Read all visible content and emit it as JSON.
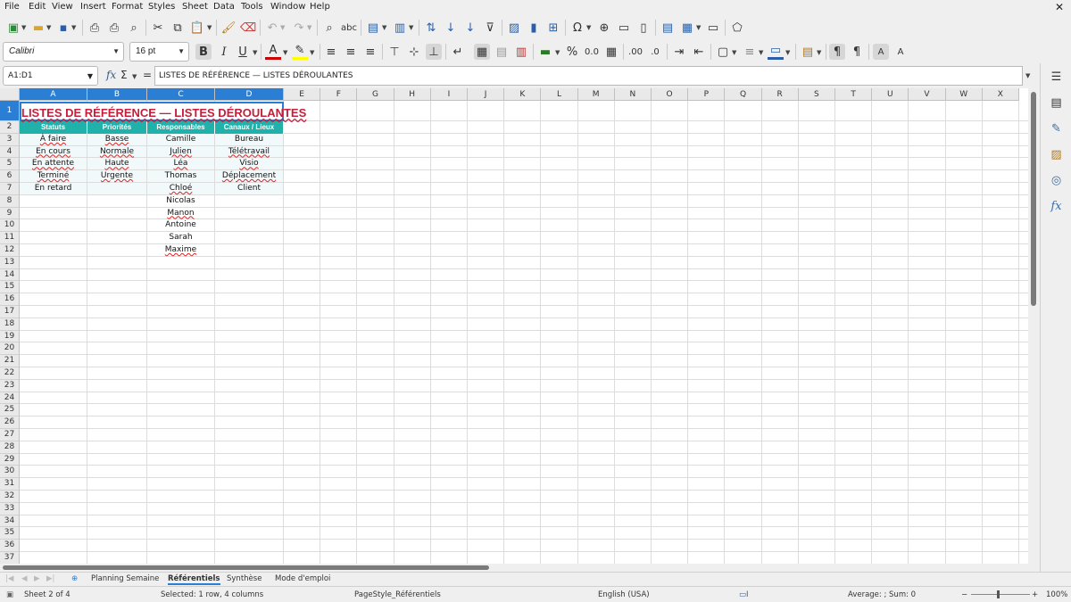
{
  "menu": [
    "File",
    "Edit",
    "View",
    "Insert",
    "Format",
    "Styles",
    "Sheet",
    "Data",
    "Tools",
    "Window",
    "Help"
  ],
  "font": {
    "name": "Calibri",
    "size": "16 pt"
  },
  "namebox": "A1:D1",
  "formula": "LISTES DE RÉFÉRENCE — LISTES DÉROULANTES",
  "columns": [
    "A",
    "B",
    "C",
    "D",
    "E",
    "F",
    "G",
    "H",
    "I",
    "J",
    "K",
    "L",
    "M",
    "N",
    "O",
    "P",
    "Q",
    "R",
    "S",
    "T",
    "U",
    "V",
    "W",
    "X"
  ],
  "sheet": {
    "title": "LISTES DE RÉFÉRENCE — LISTES DÉROULANTES",
    "headers": [
      "Statuts",
      "Priorités",
      "Responsables",
      "Canaux / Lieux"
    ],
    "statuts": [
      "À faire",
      "En cours",
      "En attente",
      "Terminé",
      "En retard"
    ],
    "priorites": [
      "Basse",
      "Normale",
      "Haute",
      "Urgente"
    ],
    "responsables": [
      "Camille",
      "Julien",
      "Léa",
      "Thomas",
      "Chloé",
      "Nicolas",
      "Manon",
      "Antoine",
      "Sarah",
      "Maxime"
    ],
    "canaux": [
      "Bureau",
      "Télétravail",
      "Visio",
      "Déplacement",
      "Client"
    ]
  },
  "tabs": [
    "Planning Semaine",
    "Référentiels",
    "Synthèse",
    "Mode d'emploi"
  ],
  "status": {
    "sheet": "Sheet 2 of 4",
    "selection": "Selected: 1 row, 4 columns",
    "pagestyle": "PageStyle_Référentiels",
    "language": "English (USA)",
    "stats": "Average: ; Sum: 0",
    "zoom": "100%"
  },
  "colors": {
    "accent": "#2a7fd4",
    "header_fill": "#20b2aa",
    "title": "#c41e3a"
  }
}
